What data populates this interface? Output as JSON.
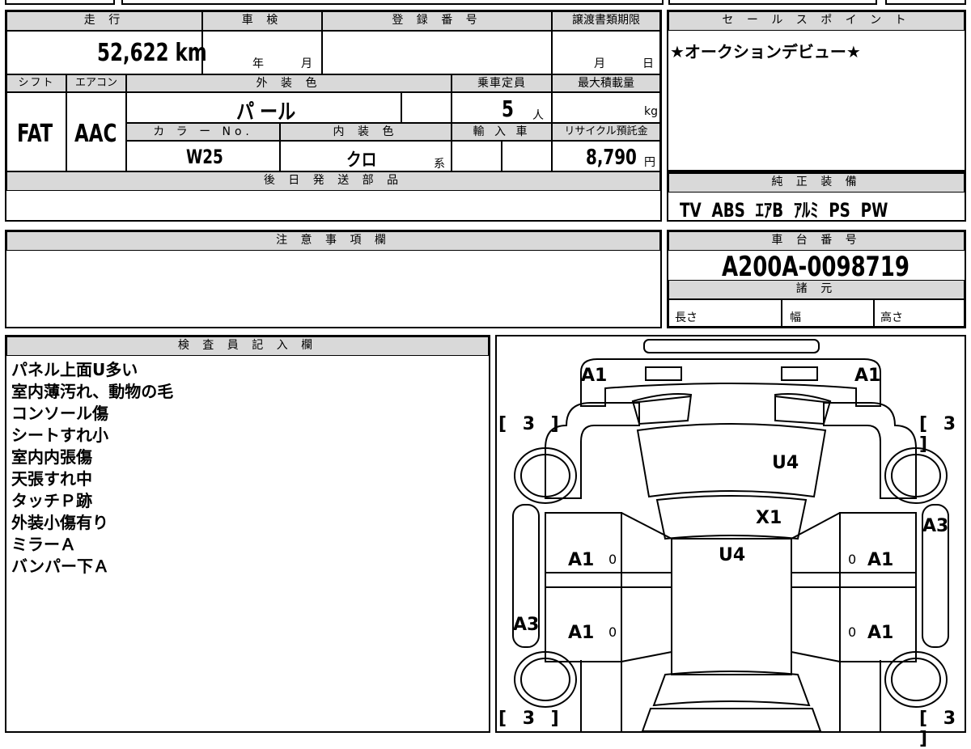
{
  "top": {
    "hdr_mileage": "走 行",
    "hdr_inspection": "車 検",
    "hdr_registration": "登 録 番 号",
    "hdr_transfer": "譲渡書類期限",
    "mileage": "52,622 km",
    "inspection_year": "年",
    "inspection_month": "月",
    "transfer_month": "月",
    "transfer_day": "日",
    "hdr_shift": "シフト",
    "hdr_aircon": "エアコン",
    "hdr_exterior": "外 装 色",
    "hdr_capacity": "乗車定員",
    "hdr_maxload": "最大積載量",
    "shift": "FAT",
    "aircon": "AAC",
    "exterior_color": "パ ール",
    "capacity": "5",
    "capacity_unit": "人",
    "maxload_unit": "kg",
    "hdr_color_no": "カ ラ ー No.",
    "hdr_interior": "内 装 色",
    "hdr_import": "輸 入 車",
    "hdr_recycle": "リサイクル預託金",
    "color_no": "W25",
    "interior_color": "クロ",
    "interior_suffix": "系",
    "recycle_fee": "8,790",
    "recycle_unit": "円",
    "hdr_later_parts": "後 日 発 送 部 品"
  },
  "sales_point": {
    "header": "セ ー ル ス ポ イ ン ト",
    "text": "★オークションデビュー★"
  },
  "equipment": {
    "header": "純 正 装 備",
    "text": "TV  ABS  ｴｱB  ｱﾙﾐ  PS  PW"
  },
  "caution": {
    "header": "注 意 事 項 欄"
  },
  "chassis": {
    "header": "車 台 番 号",
    "number": "A200A-0098719",
    "spec_header": "諸 元",
    "length_label": "長さ",
    "width_label": "幅",
    "height_label": "高さ"
  },
  "inspector": {
    "header": "検 査 員 記 入 欄",
    "notes": [
      "パネル上面U多い",
      "室内薄汚れ、動物の毛",
      "コンソール傷",
      "シートすれ小",
      "室内内張傷",
      "天張すれ中",
      "タッチＰ跡",
      "外装小傷有り",
      "ミラーＡ",
      "バンパー下Ａ"
    ]
  },
  "diagram": {
    "labels": {
      "front_left_corner": "A1",
      "front_right_corner": "A1",
      "windshield": "U4",
      "roof_front": "X1",
      "roof": "U4",
      "front_door_left": "A1",
      "front_door_right": "A1",
      "rear_door_left": "A1",
      "rear_door_right": "A1",
      "left_side": "A3",
      "right_side": "A3",
      "zero_1": "0",
      "zero_2": "0",
      "zero_3": "0",
      "zero_4": "0"
    },
    "brackets": {
      "tl": "[ 3 ]",
      "tr": "[ 3 ]",
      "bl": "[ 3 ]",
      "br": "[ 3 ]"
    }
  }
}
